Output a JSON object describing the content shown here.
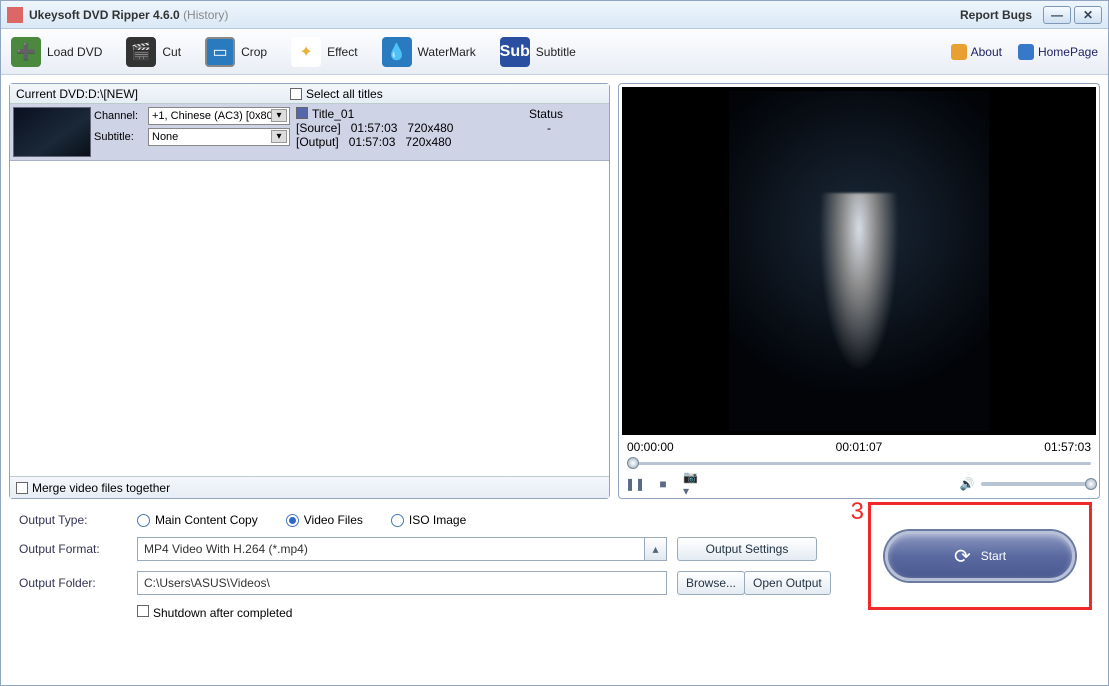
{
  "title": {
    "app": "Ukeysoft DVD Ripper 4.6.0",
    "sub": "(History)"
  },
  "titlebar": {
    "report": "Report Bugs"
  },
  "toolbar": {
    "load": "Load DVD",
    "cut": "Cut",
    "crop": "Crop",
    "effect": "Effect",
    "watermark": "WaterMark",
    "subtitle": "Subtitle",
    "about": "About",
    "homepage": "HomePage",
    "sub_glyph": "Sub"
  },
  "source": {
    "current_label": "Current DVD:D:\\[NEW]",
    "select_all": "Select all titles",
    "channel_label": "Channel:",
    "channel_value": "+1, Chinese (AC3) [0x80]",
    "subtitle_label": "Subtitle:",
    "subtitle_value": "None",
    "title_name": "Title_01",
    "status_label": "Status",
    "status_value": "-",
    "src_label": "[Source]",
    "src_dur": "01:57:03",
    "src_res": "720x480",
    "out_label": "[Output]",
    "out_dur": "01:57:03",
    "out_res": "720x480",
    "merge": "Merge video files together"
  },
  "preview": {
    "t0": "00:00:00",
    "t1": "00:01:07",
    "t2": "01:57:03"
  },
  "output": {
    "type_label": "Output Type:",
    "r1": "Main Content Copy",
    "r2": "Video Files",
    "r3": "ISO Image",
    "format_label": "Output Format:",
    "format_value": "MP4 Video With H.264 (*.mp4)",
    "settings": "Output Settings",
    "folder_label": "Output Folder:",
    "folder_value": "C:\\Users\\ASUS\\Videos\\",
    "browse": "Browse...",
    "open": "Open Output",
    "shutdown": "Shutdown after completed"
  },
  "start": "Start",
  "annotation": "3"
}
